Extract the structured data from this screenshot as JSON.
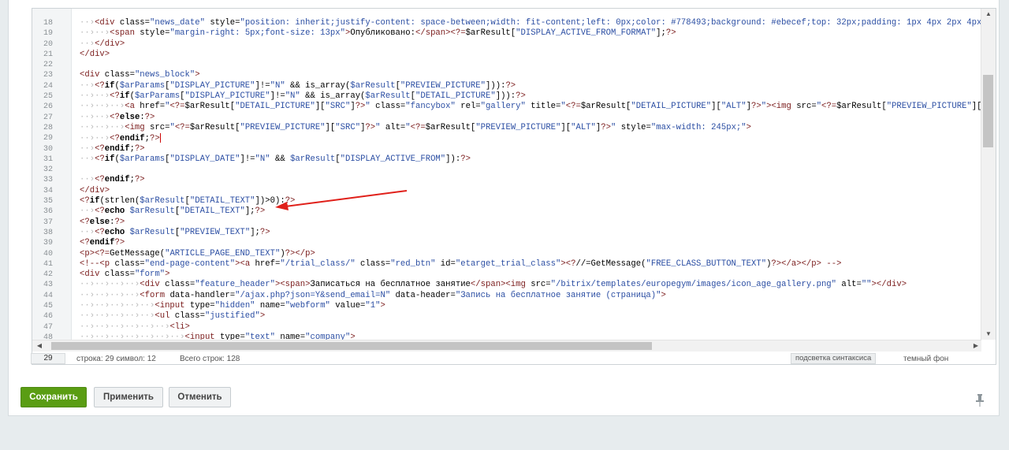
{
  "lines": [
    {
      "n": "18",
      "html": "<span class=\"t-dot\">··›</span><span class=\"t-tag\">&lt;div</span> class=<span class=\"t-str\">\"news_date\"</span> style=<span class=\"t-str\">\"position: inherit;justify-content: space-between;width: fit-content;left: 0px;color: #778493;background: #ebecef;top: 32px;padding: 1px 4px 2px 4px</span>"
    },
    {
      "n": "19",
      "html": "<span class=\"t-dot\">··›··›</span><span class=\"t-tag\">&lt;span</span> style=<span class=\"t-str\">\"margin-right: 5px;font-size: 13px\"</span><span class=\"t-tag\">&gt;</span>Опубликовано:<span class=\"t-tag\">&lt;/span&gt;&lt;?=</span>$arResult[<span class=\"t-str\">\"DISPLAY_ACTIVE_FROM_FORMAT\"</span>];<span class=\"t-tag\">?&gt;</span>"
    },
    {
      "n": "20",
      "html": "<span class=\"t-dot\">··›</span><span class=\"t-tag\">&lt;/div&gt;</span>"
    },
    {
      "n": "21",
      "html": "<span class=\"t-tag\">&lt;/div&gt;</span>"
    },
    {
      "n": "22",
      "html": ""
    },
    {
      "n": "23",
      "html": "<span class=\"t-tag\">&lt;div</span> class=<span class=\"t-str\">\"news_block\"</span><span class=\"t-tag\">&gt;</span>"
    },
    {
      "n": "24",
      "html": "<span class=\"t-dot\">··›</span><span class=\"t-tag\">&lt;?</span><b>if</b>(<span class=\"t-str\">$arParams</span>[<span class=\"t-str\">\"DISPLAY_PICTURE\"</span>]!=<span class=\"t-str\">\"N\"</span> &amp;&amp; is_array(<span class=\"t-str\">$arResult</span>[<span class=\"t-str\">\"PREVIEW_PICTURE\"</span>])):<span class=\"t-tag\">?&gt;</span>"
    },
    {
      "n": "25",
      "html": "<span class=\"t-dot\">··›··›</span><span class=\"t-tag\">&lt;?</span><b>if</b>(<span class=\"t-str\">$arParams</span>[<span class=\"t-str\">\"DISPLAY_PICTURE\"</span>]!=<span class=\"t-str\">\"N\"</span> &amp;&amp; is_array(<span class=\"t-str\">$arResult</span>[<span class=\"t-str\">\"DETAIL_PICTURE\"</span>])):<span class=\"t-tag\">?&gt;</span>"
    },
    {
      "n": "26",
      "html": "<span class=\"t-dot\">··›··›··›</span><span class=\"t-tag\">&lt;a</span> href=<span class=\"t-str\">\"</span><span class=\"t-tag\">&lt;?=</span>$arResult[<span class=\"t-str\">\"DETAIL_PICTURE\"</span>][<span class=\"t-str\">\"SRC\"</span>]<span class=\"t-tag\">?&gt;</span><span class=\"t-str\">\"</span> class=<span class=\"t-str\">\"fancybox\"</span> rel=<span class=\"t-str\">\"gallery\"</span> title=<span class=\"t-str\">\"</span><span class=\"t-tag\">&lt;?=</span>$arResult[<span class=\"t-str\">\"DETAIL_PICTURE\"</span>][<span class=\"t-str\">\"ALT\"</span>]<span class=\"t-tag\">?&gt;</span><span class=\"t-str\">\"</span><span class=\"t-tag\">&gt;&lt;img</span> src=<span class=\"t-str\">\"</span><span class=\"t-tag\">&lt;?=</span>$arResult[<span class=\"t-str\">\"PREVIEW_PICTURE\"</span>][<span class=\"t-str\">\"S</span>"
    },
    {
      "n": "27",
      "html": "<span class=\"t-dot\">··›··›</span><span class=\"t-tag\">&lt;?</span><b>else</b>:<span class=\"t-tag\">?&gt;</span>"
    },
    {
      "n": "28",
      "html": "<span class=\"t-dot\">··›··›··›</span><span class=\"t-tag\">&lt;img</span> src=<span class=\"t-str\">\"</span><span class=\"t-tag\">&lt;?=</span>$arResult[<span class=\"t-str\">\"PREVIEW_PICTURE\"</span>][<span class=\"t-str\">\"SRC\"</span>]<span class=\"t-tag\">?&gt;</span><span class=\"t-str\">\"</span> alt=<span class=\"t-str\">\"</span><span class=\"t-tag\">&lt;?=</span>$arResult[<span class=\"t-str\">\"PREVIEW_PICTURE\"</span>][<span class=\"t-str\">\"ALT\"</span>]<span class=\"t-tag\">?&gt;</span><span class=\"t-str\">\"</span> style=<span class=\"t-str\">\"max-width: 245px;\"</span><span class=\"t-tag\">&gt;</span>"
    },
    {
      "n": "29",
      "html": "<span class=\"t-dot\">··›··›</span><span class=\"t-tag\">&lt;?</span><b>endif</b>;<span class=\"t-tag\">?&gt;</span><span class=\"cursor\"></span>"
    },
    {
      "n": "30",
      "html": "<span class=\"t-dot\">··›</span><span class=\"t-tag\">&lt;?</span><b>endif</b>;<span class=\"t-tag\">?&gt;</span>"
    },
    {
      "n": "31",
      "html": "<span class=\"t-dot\">··›</span><span class=\"t-tag\">&lt;?</span><b>if</b>(<span class=\"t-str\">$arParams</span>[<span class=\"t-str\">\"DISPLAY_DATE\"</span>]!=<span class=\"t-str\">\"N\"</span> &amp;&amp; <span class=\"t-str\">$arResult</span>[<span class=\"t-str\">\"DISPLAY_ACTIVE_FROM\"</span>]):<span class=\"t-tag\">?&gt;</span>"
    },
    {
      "n": "32",
      "html": ""
    },
    {
      "n": "33",
      "html": "<span class=\"t-dot\">··›</span><span class=\"t-tag\">&lt;?</span><b>endif</b>;<span class=\"t-tag\">?&gt;</span>"
    },
    {
      "n": "34",
      "html": "<span class=\"t-tag\">&lt;/div&gt;</span>"
    },
    {
      "n": "35",
      "html": "<span class=\"t-tag\">&lt;?</span><b>if</b>(strlen(<span class=\"t-str\">$arResult</span>[<span class=\"t-str\">\"DETAIL_TEXT\"</span>])&gt;0):<span class=\"t-tag\">?&gt;</span>"
    },
    {
      "n": "36",
      "html": "<span class=\"t-dot\">··›</span><span class=\"t-tag\">&lt;?</span><b>echo</b> <span class=\"t-str\">$arResult</span>[<span class=\"t-str\">\"DETAIL_TEXT\"</span>];<span class=\"t-tag\">?&gt;</span>"
    },
    {
      "n": "37",
      "html": "<span class=\"t-tag\">&lt;?</span><b>else</b>:<span class=\"t-tag\">?&gt;</span>"
    },
    {
      "n": "38",
      "html": "<span class=\"t-dot\">··›</span><span class=\"t-tag\">&lt;?</span><b>echo</b> <span class=\"t-str\">$arResult</span>[<span class=\"t-str\">\"PREVIEW_TEXT\"</span>];<span class=\"t-tag\">?&gt;</span>"
    },
    {
      "n": "39",
      "html": "<span class=\"t-tag\">&lt;?</span><b>endif</b><span class=\"t-tag\">?&gt;</span>"
    },
    {
      "n": "40",
      "html": "<span class=\"t-tag\">&lt;p&gt;&lt;?=</span>GetMessage(<span class=\"t-str\">\"ARTICLE_PAGE_END_TEXT\"</span>)<span class=\"t-tag\">?&gt;&lt;/p&gt;</span>"
    },
    {
      "n": "41",
      "html": "<span class=\"t-tag\">&lt;!--&lt;p</span> class=<span class=\"t-str\">\"end-page-content\"</span><span class=\"t-tag\">&gt;&lt;a</span> href=<span class=\"t-str\">\"/trial_class/\"</span> class=<span class=\"t-str\">\"red_btn\"</span> id=<span class=\"t-str\">\"etarget_trial_class\"</span><span class=\"t-tag\">&gt;&lt;?</span>//=GetMessage(<span class=\"t-str\">\"FREE_CLASS_BUTTON_TEXT\"</span>)<span class=\"t-tag\">?&gt;&lt;/a&gt;&lt;/p&gt; --&gt;</span>"
    },
    {
      "n": "42",
      "html": "<span class=\"t-tag\">&lt;div</span> class=<span class=\"t-str\">\"form\"</span><span class=\"t-tag\">&gt;</span>"
    },
    {
      "n": "43",
      "html": "<span class=\"t-dot\">··›··›··›··›</span><span class=\"t-tag\">&lt;div</span> class=<span class=\"t-str\">\"feature_header\"</span><span class=\"t-tag\">&gt;&lt;span&gt;</span>Записаться на бесплатное занятие<span class=\"t-tag\">&lt;/span&gt;&lt;img</span> src=<span class=\"t-str\">\"/bitrix/templates/europegym/images/icon_age_gallery.png\"</span> alt=<span class=\"t-str\">\"\"</span><span class=\"t-tag\">&gt;&lt;/div&gt;</span>"
    },
    {
      "n": "44",
      "html": "<span class=\"t-dot\">··›··›··›··›</span><span class=\"t-tag\">&lt;form</span> data-handler=<span class=\"t-str\">\"/ajax.php?json=Y&amp;send_email=N\"</span> data-header=<span class=\"t-str\">\"Запись на бесплатное занятие (страница)\"</span><span class=\"t-tag\">&gt;</span>"
    },
    {
      "n": "45",
      "html": "<span class=\"t-dot\">··›··›··›··›··›</span><span class=\"t-tag\">&lt;input</span> type=<span class=\"t-str\">\"hidden\"</span> name=<span class=\"t-str\">\"webform\"</span> value=<span class=\"t-str\">\"1\"</span><span class=\"t-tag\">&gt;</span>"
    },
    {
      "n": "46",
      "html": "<span class=\"t-dot\">··›··›··›··›··›</span><span class=\"t-tag\">&lt;ul</span> class=<span class=\"t-str\">\"justified\"</span><span class=\"t-tag\">&gt;</span>"
    },
    {
      "n": "47",
      "html": "<span class=\"t-dot\">··›··›··›··›··›··›</span><span class=\"t-tag\">&lt;li&gt;</span>"
    },
    {
      "n": "48",
      "html": "<span class=\"t-dot\">··›··›··›··›··›··›··›</span><span class=\"t-tag\">&lt;input</span> type=<span class=\"t-str\">\"text\"</span> name=<span class=\"t-str\">\"company\"</span><span class=\"t-tag\">&gt;</span>"
    }
  ],
  "status": {
    "line_box": "29",
    "position": "строка: 29  символ: 12",
    "total": "Всего строк: 128",
    "syntax_label": "подсветка синтаксиса",
    "dark_theme": "темный фон"
  },
  "buttons": {
    "save": "Сохранить",
    "apply": "Применить",
    "cancel": "Отменить"
  },
  "colors": {
    "save_bg": "#5a9d13",
    "annotation_arrow": "#e0201a"
  }
}
